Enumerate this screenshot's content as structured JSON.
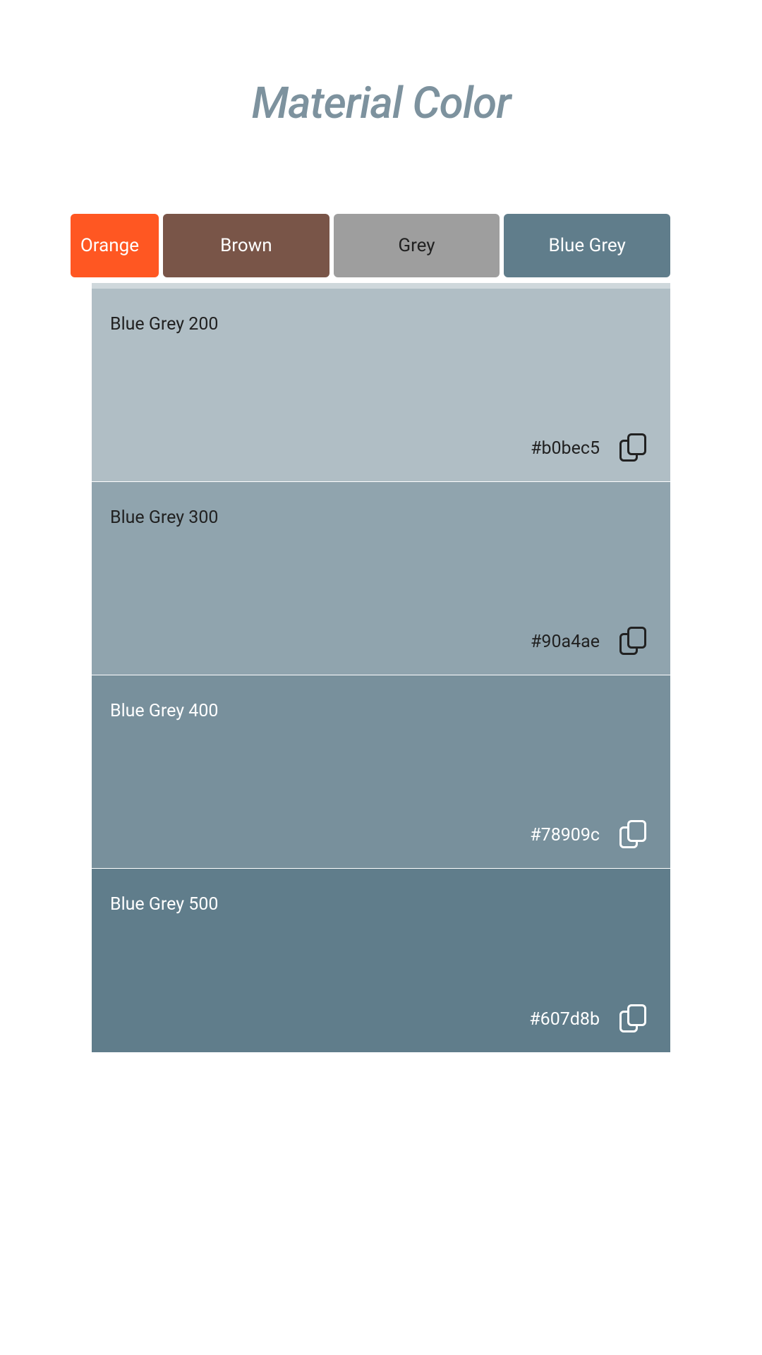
{
  "header": {
    "title": "Material Color"
  },
  "tabs": {
    "orange": {
      "label": "Orange",
      "color": "#ff5722",
      "text_color": "#ffffff"
    },
    "brown": {
      "label": "Brown",
      "color": "#795548",
      "text_color": "#ffffff"
    },
    "grey": {
      "label": "Grey",
      "color": "#9e9e9e",
      "text_color": "#212121"
    },
    "bluegrey": {
      "label": "Blue Grey",
      "color": "#607d8b",
      "text_color": "#ffffff",
      "active": true
    }
  },
  "swatches": [
    {
      "name": "Blue Grey 200",
      "hex": "#b0bec5",
      "text_theme": "dark"
    },
    {
      "name": "Blue Grey 300",
      "hex": "#90a4ae",
      "text_theme": "dark"
    },
    {
      "name": "Blue Grey 400",
      "hex": "#78909c",
      "text_theme": "light"
    },
    {
      "name": "Blue Grey 500",
      "hex": "#607d8b",
      "text_theme": "light"
    }
  ]
}
